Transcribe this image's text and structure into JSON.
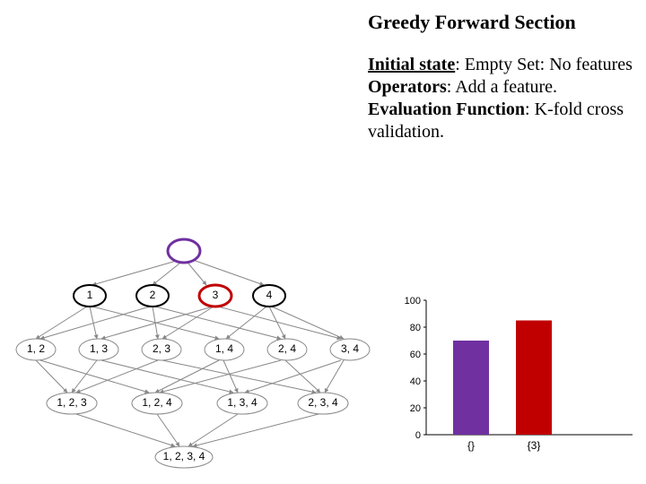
{
  "title": "Greedy Forward Section",
  "desc": {
    "initial_label": "Initial state",
    "initial_value": ": Empty Set: No features",
    "operators_label": "Operators",
    "operators_value": ": Add a feature.",
    "eval_label": "Evaluation Function",
    "eval_value": ": K-fold cross validation."
  },
  "nodes": {
    "root": "",
    "n1": "1",
    "n2": "2",
    "n3": "3",
    "n4": "4",
    "n12": "1, 2",
    "n13": "1, 3",
    "n23": "2, 3",
    "n14": "1, 4",
    "n24": "2, 4",
    "n34": "3, 4",
    "n123": "1, 2, 3",
    "n124": "1, 2, 4",
    "n134": "1, 3, 4",
    "n234": "2, 3, 4",
    "n1234": "1, 2, 3, 4"
  },
  "chart_data": {
    "type": "bar",
    "categories": [
      "{}",
      "{3}"
    ],
    "values": [
      70,
      85
    ],
    "colors": [
      "#7030A0",
      "#C00000"
    ],
    "ylim": [
      0,
      100
    ],
    "yticks": [
      0,
      20,
      40,
      60,
      80,
      100
    ],
    "title": "",
    "xlabel": "",
    "ylabel": ""
  }
}
